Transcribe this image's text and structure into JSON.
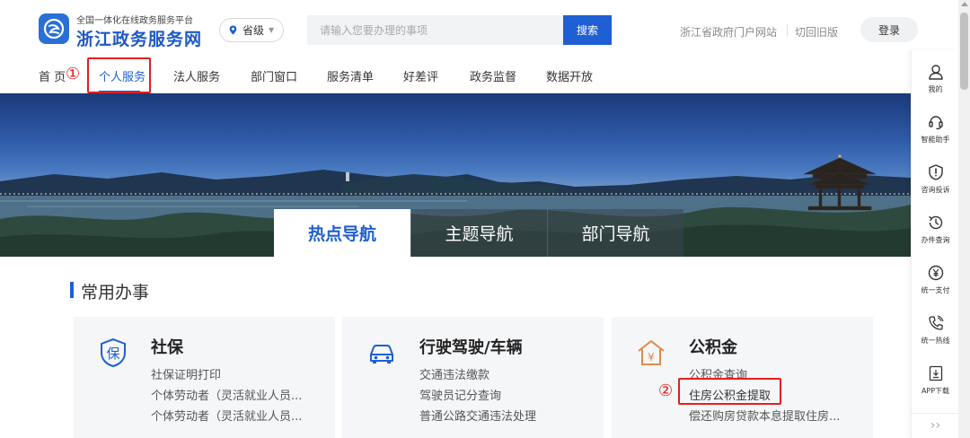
{
  "header": {
    "platform_subtitle": "全国一体化在线政务服务平台",
    "site_title": "浙江政务服务网",
    "region_selected": "省级",
    "search_placeholder": "请输入您要办理的事项",
    "search_button": "搜索",
    "link_portal": "浙江省政府门户网站",
    "link_old_version": "切回旧版",
    "login_button": "登录"
  },
  "nav": {
    "items": [
      {
        "label": "首 页"
      },
      {
        "label": "个人服务",
        "active": true
      },
      {
        "label": "法人服务"
      },
      {
        "label": "部门窗口"
      },
      {
        "label": "服务清单"
      },
      {
        "label": "好差评"
      },
      {
        "label": "政务监督"
      },
      {
        "label": "数据开放"
      }
    ]
  },
  "annotations": {
    "step1": "①",
    "step2": "②",
    "color": "#e41e1e"
  },
  "banner_tabs": [
    {
      "label": "热点导航",
      "active": true
    },
    {
      "label": "主题导航"
    },
    {
      "label": "部门导航"
    }
  ],
  "section": {
    "title": "常用办事"
  },
  "cards": [
    {
      "icon": "shield-bao-icon",
      "title": "社保",
      "links": [
        "社保证明打印",
        "个体劳动者（灵活就业人员...",
        "个体劳动者（灵活就业人员..."
      ]
    },
    {
      "icon": "car-icon",
      "title": "行驶驾驶/车辆",
      "links": [
        "交通违法缴款",
        "驾驶员记分查询",
        "普通公路交通违法处理"
      ]
    },
    {
      "icon": "house-yuan-icon",
      "title": "公积金",
      "links": [
        "公积金查询",
        "住房公积金提取",
        "偿还购房贷款本息提取住房..."
      ]
    }
  ],
  "sidebar": {
    "items": [
      {
        "label": "我的",
        "icon": "user-icon"
      },
      {
        "label": "智能助手",
        "icon": "headset-icon"
      },
      {
        "label": "咨询投诉",
        "icon": "alert-icon"
      },
      {
        "label": "办件查询",
        "icon": "history-icon"
      },
      {
        "label": "统一支付",
        "icon": "yuan-icon"
      },
      {
        "label": "统一热线",
        "icon": "phone-icon"
      },
      {
        "label": "APP下载",
        "icon": "download-icon"
      }
    ],
    "more": "››"
  },
  "colors": {
    "primary": "#1f5fd4",
    "annotation_red": "#e41e1e"
  }
}
